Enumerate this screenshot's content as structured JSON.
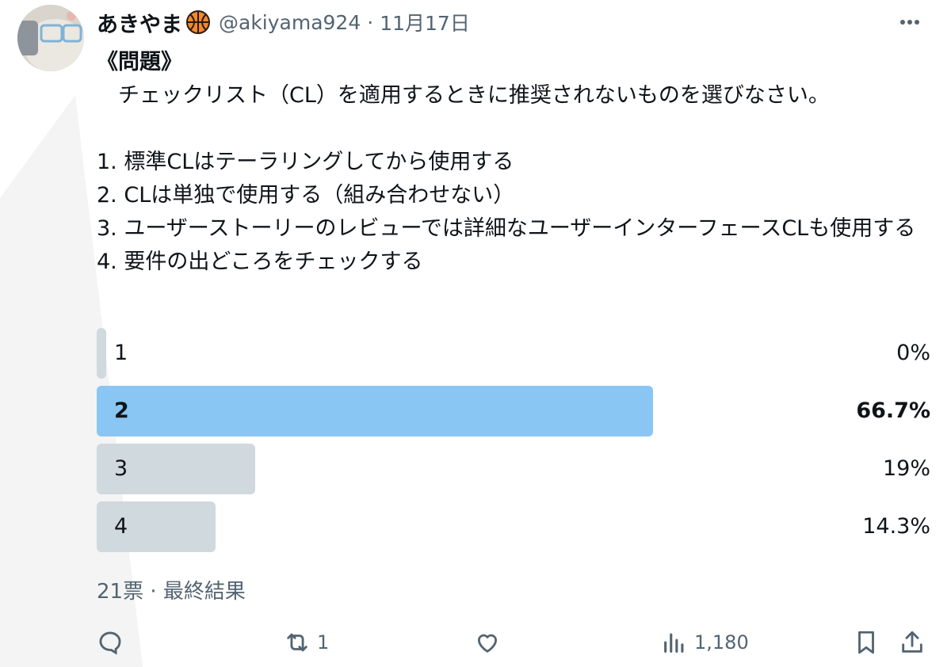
{
  "tweet": {
    "display_name": "あきやま",
    "handle": "@akiyama924",
    "separator": "·",
    "date": "11月17日",
    "title": "《問題》",
    "text": "　チェックリスト（CL）を適用するときに推奨されないものを選びなさい。\n\n1. 標準CLはテーラリングしてから使用する\n2. CLは単独で使用する（組み合わせない）\n3. ユーザーストーリーのレビューでは詳細なユーザーインターフェースCLも使用する\n4. 要件の出どころをチェックする"
  },
  "poll": {
    "options": [
      {
        "label": "1",
        "percent_text": "0%",
        "percent": 0,
        "winner": false
      },
      {
        "label": "2",
        "percent_text": "66.7%",
        "percent": 66.7,
        "winner": true
      },
      {
        "label": "3",
        "percent_text": "19%",
        "percent": 19,
        "winner": false
      },
      {
        "label": "4",
        "percent_text": "14.3%",
        "percent": 14.3,
        "winner": false
      }
    ],
    "meta": "21票 · 最終結果"
  },
  "actions": {
    "reply_count": "",
    "retweet_count": "1",
    "like_count": "",
    "views_count": "1,180"
  },
  "colors": {
    "winner_bar": "#8ac6f4",
    "other_bar": "#cfd9de",
    "secondary_text": "#536471"
  },
  "icons": [
    "more-icon",
    "basketball-icon",
    "reply-icon",
    "retweet-icon",
    "like-icon",
    "views-icon",
    "bookmark-icon",
    "share-icon"
  ]
}
